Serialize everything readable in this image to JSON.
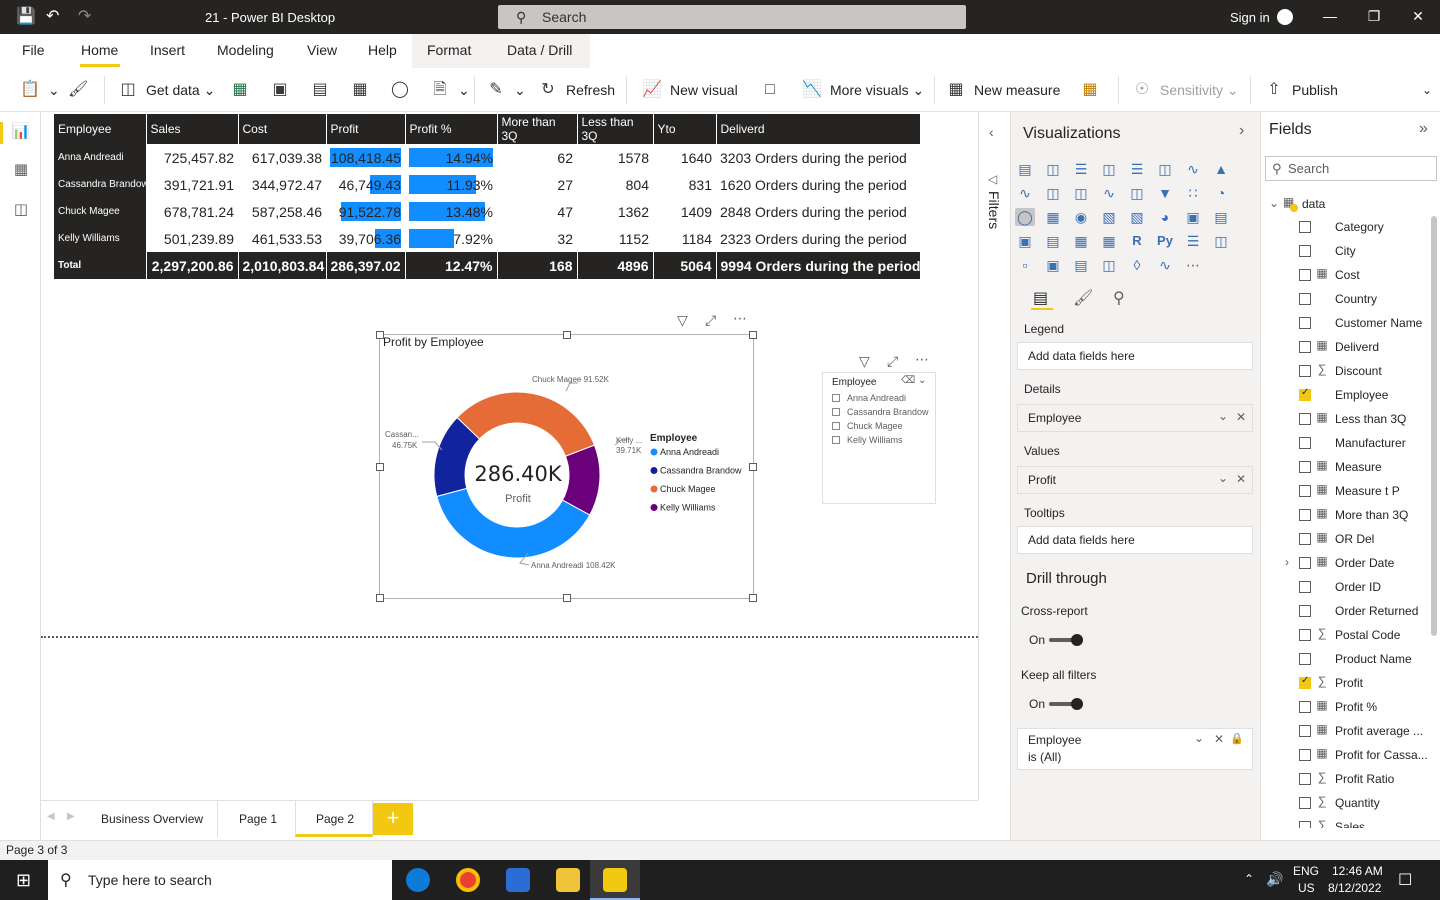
{
  "titlebar": {
    "title": "21 - Power BI Desktop",
    "search_placeholder": "Search",
    "signin": "Sign in"
  },
  "menu": {
    "tabs": [
      "File",
      "Home",
      "Insert",
      "Modeling",
      "View",
      "Help",
      "Format",
      "Data / Drill"
    ]
  },
  "ribbon": {
    "get_data": "Get data",
    "refresh": "Refresh",
    "new_visual": "New visual",
    "more_visuals": "More visuals",
    "new_measure": "New measure",
    "sensitivity": "Sensitivity",
    "publish": "Publish"
  },
  "matrix": {
    "headers": [
      "Employee",
      "Sales",
      "Cost",
      "Profit",
      "Profit %",
      "More than 3Q",
      "Less than 3Q",
      "Yto",
      "Deliverd"
    ],
    "rows": [
      {
        "employee": "Anna Andreadi",
        "sales": "725,457.82",
        "cost": "617,039.38",
        "profit": "108,418.45",
        "profit_pct": "14.94%",
        "more3q": "62",
        "less3q": "1578",
        "yto": "1640",
        "deliverd": "3203 Orders during the period",
        "profit_bar": 1.0,
        "pct_bar": 1.0
      },
      {
        "employee": "Cassandra Brandow",
        "sales": "391,721.91",
        "cost": "344,972.47",
        "profit": "46,749.43",
        "profit_pct": "11.93%",
        "more3q": "27",
        "less3q": "804",
        "yto": "831",
        "deliverd": "1620 Orders during the period",
        "profit_bar": 0.43,
        "pct_bar": 0.8
      },
      {
        "employee": "Chuck Magee",
        "sales": "678,781.24",
        "cost": "587,258.46",
        "profit": "91,522.78",
        "profit_pct": "13.48%",
        "more3q": "47",
        "less3q": "1362",
        "yto": "1409",
        "deliverd": "2848 Orders during the period",
        "profit_bar": 0.84,
        "pct_bar": 0.9
      },
      {
        "employee": "Kelly Williams",
        "sales": "501,239.89",
        "cost": "461,533.53",
        "profit": "39,706.36",
        "profit_pct": "7.92%",
        "more3q": "32",
        "less3q": "1152",
        "yto": "1184",
        "deliverd": "2323 Orders during the period",
        "profit_bar": 0.37,
        "pct_bar": 0.53
      }
    ],
    "total": {
      "employee": "Total",
      "sales": "2,297,200.86",
      "cost": "2,010,803.84",
      "profit": "286,397.02",
      "profit_pct": "12.47%",
      "more3q": "168",
      "less3q": "4896",
      "yto": "5064",
      "deliverd": "9994 Orders during the period"
    }
  },
  "donut": {
    "title": "Profit by Employee",
    "center_value": "286.40K",
    "center_label": "Profit",
    "legend_title": "Employee",
    "slices": [
      {
        "name": "Anna Andreadi",
        "value": 108.42,
        "label": "Anna Andreadi 108.42K",
        "color": "#118dff"
      },
      {
        "name": "Cassandra Brandow",
        "value": 46.75,
        "label_a": "Cassan...",
        "label_b": "46.75K",
        "color": "#12239e"
      },
      {
        "name": "Chuck Magee",
        "value": 91.52,
        "label": "Chuck Magee 91.52K",
        "color": "#e66c37"
      },
      {
        "name": "Kelly Williams",
        "value": 39.71,
        "label_a": "Kelly ...",
        "label_b": "39.71K",
        "color": "#6b007b"
      }
    ]
  },
  "slicer": {
    "title": "Employee",
    "items": [
      "Anna Andreadi",
      "Cassandra Brandow",
      "Chuck Magee",
      "Kelly Williams"
    ]
  },
  "pages": {
    "tabs": [
      "Business Overview",
      "Page 1",
      "Page 2"
    ],
    "active": "Page 2",
    "status": "Page 3 of 3"
  },
  "filters": {
    "label": "Filters"
  },
  "viz": {
    "title": "Visualizations",
    "legend_label": "Legend",
    "legend_placeholder": "Add data fields here",
    "details_label": "Details",
    "details_value": "Employee",
    "values_label": "Values",
    "values_value": "Profit",
    "tooltips_label": "Tooltips",
    "tooltips_placeholder": "Add data fields here",
    "drill_title": "Drill through",
    "cross_report": "Cross-report",
    "cross_state": "On",
    "keep_filters": "Keep all filters",
    "keep_state": "On",
    "filter_card_field": "Employee",
    "filter_card_value": "is (All)"
  },
  "fields": {
    "title": "Fields",
    "search_placeholder": "Search",
    "table": "data",
    "items": [
      {
        "name": "Category",
        "icon": "",
        "checked": false
      },
      {
        "name": "City",
        "icon": "",
        "checked": false
      },
      {
        "name": "Cost",
        "icon": "calc",
        "checked": false
      },
      {
        "name": "Country",
        "icon": "",
        "checked": false
      },
      {
        "name": "Customer Name",
        "icon": "",
        "checked": false
      },
      {
        "name": "Deliverd",
        "icon": "calc",
        "checked": false
      },
      {
        "name": "Discount",
        "icon": "sigma",
        "checked": false
      },
      {
        "name": "Employee",
        "icon": "",
        "checked": true
      },
      {
        "name": "Less than 3Q",
        "icon": "calc",
        "checked": false
      },
      {
        "name": "Manufacturer",
        "icon": "",
        "checked": false
      },
      {
        "name": "Measure",
        "icon": "calc",
        "checked": false
      },
      {
        "name": "Measure t P",
        "icon": "calc",
        "checked": false
      },
      {
        "name": "More than 3Q",
        "icon": "calc",
        "checked": false
      },
      {
        "name": "OR Del",
        "icon": "calc",
        "checked": false
      },
      {
        "name": "Order Date",
        "icon": "calendar",
        "checked": false
      },
      {
        "name": "Order ID",
        "icon": "",
        "checked": false
      },
      {
        "name": "Order Returned",
        "icon": "",
        "checked": false
      },
      {
        "name": "Postal Code",
        "icon": "sigma",
        "checked": false
      },
      {
        "name": "Product Name",
        "icon": "",
        "checked": false
      },
      {
        "name": "Profit",
        "icon": "sigma",
        "checked": true
      },
      {
        "name": "Profit %",
        "icon": "calc",
        "checked": false
      },
      {
        "name": "Profit average ...",
        "icon": "calc",
        "checked": false
      },
      {
        "name": "Profit for Cassa...",
        "icon": "calc",
        "checked": false
      },
      {
        "name": "Profit Ratio",
        "icon": "sigma",
        "checked": false
      },
      {
        "name": "Quantity",
        "icon": "sigma",
        "checked": false
      },
      {
        "name": "Sales",
        "icon": "sigma",
        "checked": false
      }
    ]
  },
  "taskbar": {
    "search_placeholder": "Type here to search",
    "lang_a": "ENG",
    "lang_b": "US",
    "time": "12:46 AM",
    "date": "8/12/2022"
  }
}
